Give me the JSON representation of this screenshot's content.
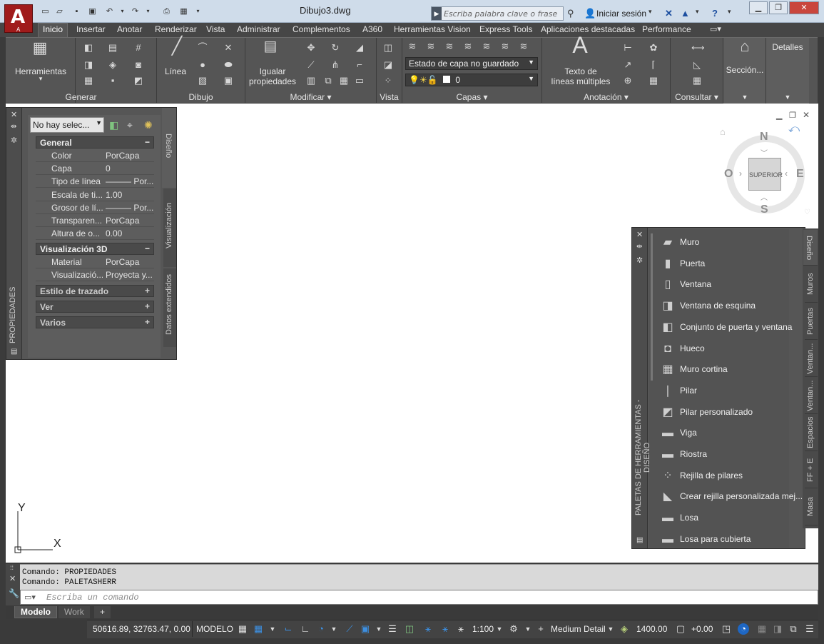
{
  "app": {
    "logo_letter": "A",
    "logo_sub": "A",
    "document_title": "Dibujo3.dwg",
    "search_placeholder": "Escriba palabra clave o frase",
    "signin_label": "Iniciar sesión"
  },
  "tabs": [
    "Inicio",
    "Insertar",
    "Anotar",
    "Renderizar",
    "Vista",
    "Administrar",
    "Complementos",
    "A360",
    "Herramientas Vision",
    "Express Tools",
    "Aplicaciones destacadas",
    "Performance"
  ],
  "ribbon": {
    "panels": {
      "generar": "Generar",
      "dibujo": "Dibujo",
      "modificar": "Modificar",
      "vista": "Vista",
      "capas": "Capas",
      "anotacion": "Anotación",
      "consultar": "Consultar"
    },
    "herramientas_label": "Herramientas",
    "linea_label": "Línea",
    "igualar_line1": "Igualar",
    "igualar_line2": "propiedades",
    "layer_state": "Estado de capa no guardado",
    "layer_current": "0",
    "texto_line1": "Texto de",
    "texto_line2": "líneas múltiples",
    "seccion_label": "Sección...",
    "detalles_label": "Detalles"
  },
  "properties": {
    "palette_title": "PROPIEDADES",
    "selection": "No hay selec...",
    "tabs": [
      "Diseño",
      "Visualización",
      "Datos extendidos"
    ],
    "sections": {
      "general": "General",
      "vis3d": "Visualización 3D",
      "estilo": "Estilo de trazado",
      "ver": "Ver",
      "varios": "Varios"
    },
    "general_rows": [
      {
        "k": "Color",
        "v": "PorCapa"
      },
      {
        "k": "Capa",
        "v": "0"
      },
      {
        "k": "Tipo de línea",
        "v": "——— Por..."
      },
      {
        "k": "Escala de ti...",
        "v": "1.00"
      },
      {
        "k": "Grosor de lí...",
        "v": "——— Por..."
      },
      {
        "k": "Transparen...",
        "v": "PorCapa"
      },
      {
        "k": "Altura de o...",
        "v": "0.00"
      }
    ],
    "vis3d_rows": [
      {
        "k": "Material",
        "v": "PorCapa"
      },
      {
        "k": "Visualizació...",
        "v": "Proyecta y..."
      }
    ]
  },
  "tool_palette": {
    "title": "PALETAS DE HERRAMIENTAS - DISEÑO",
    "items": [
      "Muro",
      "Puerta",
      "Ventana",
      "Ventana de esquina",
      "Conjunto de puerta y ventana",
      "Hueco",
      "Muro cortina",
      "Pilar",
      "Pilar personalizado",
      "Viga",
      "Riostra",
      "Rejilla de pilares",
      "Crear  rejilla  personalizada mej...",
      "Losa",
      "Losa para cubierta"
    ],
    "tabs": [
      "Diseño",
      "Muros",
      "Puertas",
      "Ventan...",
      "Ventan...",
      "Espacios",
      "FF + E",
      "Masa"
    ]
  },
  "viewcube": {
    "north": "N",
    "south": "S",
    "east": "E",
    "west": "O",
    "face": "SUPERIOR"
  },
  "ucs": {
    "x": "X",
    "y": "Y"
  },
  "command": {
    "history": [
      "Comando: PROPIEDADES",
      "Comando: PALETASHERR"
    ],
    "placeholder": "Escriba un comando"
  },
  "layout_tabs": [
    "Modelo",
    "Work",
    "+"
  ],
  "status": {
    "coords": "50616.89, 32763.47, 0.00",
    "mode": "MODELO",
    "scale": "1:100",
    "detail": "Medium Detail",
    "elevation": "1400.00",
    "offset": "+0.00"
  }
}
